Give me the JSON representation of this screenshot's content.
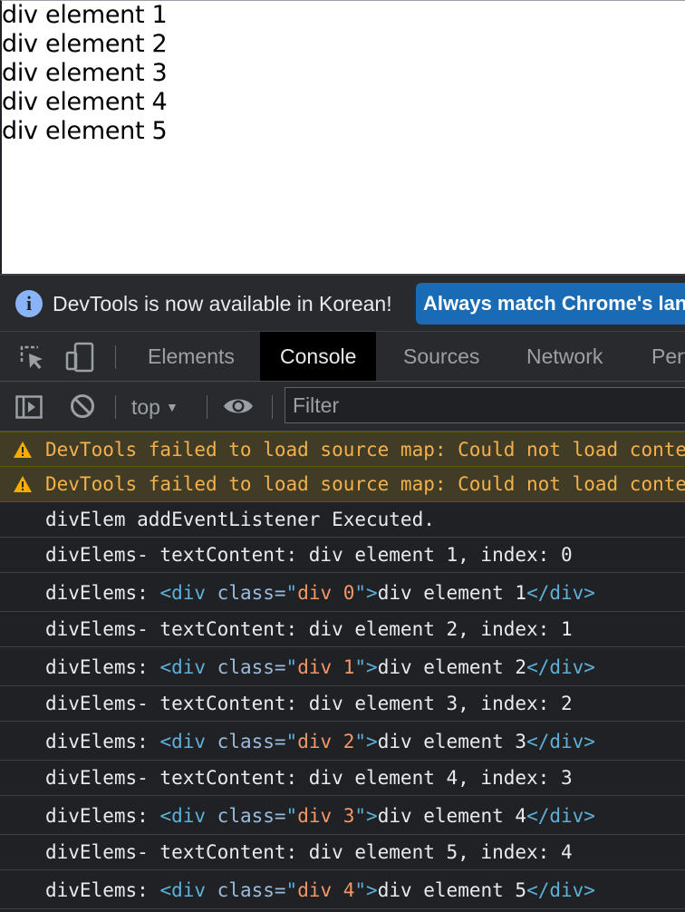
{
  "page": {
    "lines": [
      "div element 1",
      "div element 2",
      "div element 3",
      "div element 4",
      "div element 5"
    ]
  },
  "infobar": {
    "message": "DevTools is now available in Korean!",
    "button_label": "Always match Chrome's language"
  },
  "tabs": [
    {
      "label": "Elements",
      "active": false
    },
    {
      "label": "Console",
      "active": true
    },
    {
      "label": "Sources",
      "active": false
    },
    {
      "label": "Network",
      "active": false
    },
    {
      "label": "Performance",
      "active": false
    }
  ],
  "toolbar": {
    "context": "top",
    "filter_placeholder": "Filter"
  },
  "console": {
    "warnings": [
      "DevTools failed to load source map: Could not load content",
      "DevTools failed to load source map: Could not load content"
    ],
    "executed_message": "divElem addEventListener Executed.",
    "entries": [
      {
        "text": "divElems- textContent: div element 1, index: 0",
        "label": "divElems:",
        "cls": "div 0",
        "content": "div element 1"
      },
      {
        "text": "divElems- textContent: div element 2, index: 1",
        "label": "divElems:",
        "cls": "div 1",
        "content": "div element 2"
      },
      {
        "text": "divElems- textContent: div element 3, index: 2",
        "label": "divElems:",
        "cls": "div 2",
        "content": "div element 3"
      },
      {
        "text": "divElems- textContent: div element 4, index: 3",
        "label": "divElems:",
        "cls": "div 3",
        "content": "div element 4"
      },
      {
        "text": "divElems- textContent: div element 5, index: 4",
        "label": "divElems:",
        "cls": "div 4",
        "content": "div element 5"
      }
    ]
  },
  "colors": {
    "devtools_bg": "#202124",
    "warning_bg": "#413c26",
    "warning_text": "#f5b04c",
    "accent_blue": "#1a6bb5",
    "tag_color": "#5db0d7",
    "attr_value_color": "#f29766"
  }
}
